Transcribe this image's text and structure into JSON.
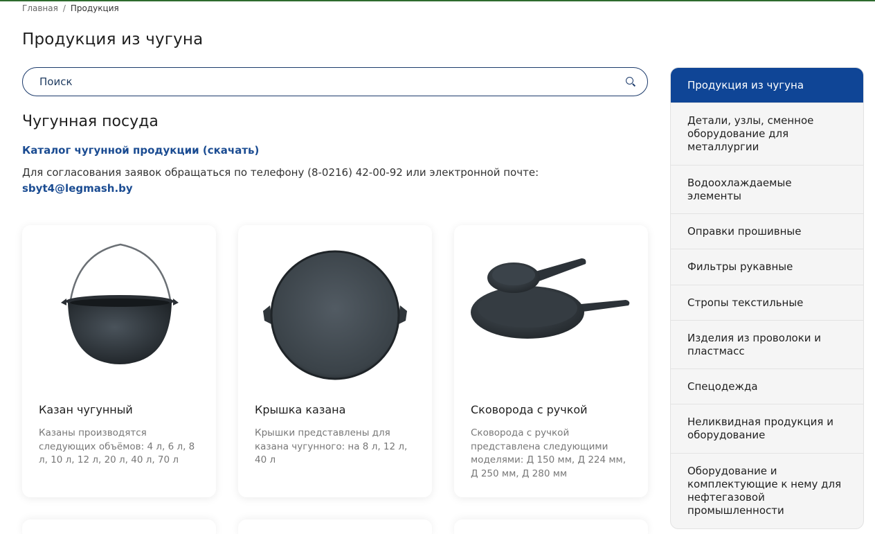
{
  "breadcrumb": {
    "home": "Главная",
    "separator": "/",
    "current": "Продукция"
  },
  "page_title": "Продукция из чугуна",
  "search": {
    "placeholder": "Поиск",
    "value": ""
  },
  "section_title": "Чугунная посуда",
  "catalog_link": "Каталог чугунной продукции (скачать)",
  "contact": {
    "text": "Для согласования заявок обращаться по телефону (8-0216) 42-00-92 или электронной почте:",
    "email": "sbyt4@legmash.by"
  },
  "products": [
    {
      "name": "Казан чугунный",
      "description": "Казаны производятся следующих объёмов: 4 л, 6 л, 8 л, 10 л, 12 л, 20 л, 40 л, 70 л"
    },
    {
      "name": "Крышка казана",
      "description": "Крышки представлены для казана чугунного: на 8 л, 12 л, 40 л"
    },
    {
      "name": "Сковорода с ручкой",
      "description": "Сковорода с ручкой представлена следующими моделями: Д 150 мм, Д 224 мм, Д 250 мм, Д 280 мм"
    }
  ],
  "sidebar": {
    "items": [
      {
        "label": "Продукция из чугуна",
        "active": true
      },
      {
        "label": "Детали, узлы, сменное оборудование для металлургии"
      },
      {
        "label": "Водоохлаждаемые элементы"
      },
      {
        "label": "Оправки прошивные"
      },
      {
        "label": "Фильтры рукавные"
      },
      {
        "label": "Стропы текстильные"
      },
      {
        "label": "Изделия из проволоки и пластмасс"
      },
      {
        "label": "Спецодежда"
      },
      {
        "label": "Неликвидная продукция и оборудование"
      },
      {
        "label": "Оборудование и комплектующие к нему для нефтегазовой промышленности"
      }
    ]
  },
  "colors": {
    "accent": "#0f4596",
    "link": "#1b4c92",
    "top_line": "#2e6b2e",
    "iron": "#2c3238"
  }
}
